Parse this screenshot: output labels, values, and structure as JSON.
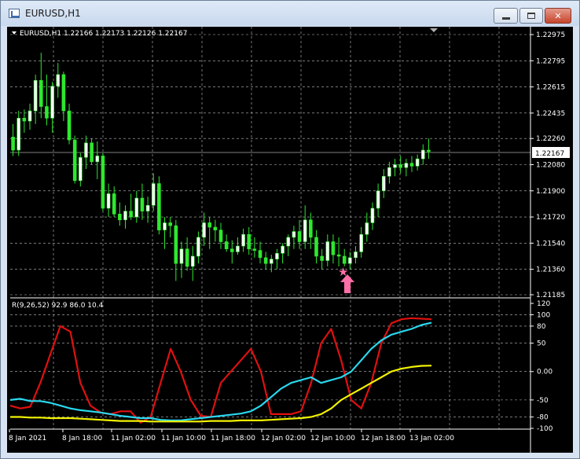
{
  "window": {
    "title": "EURUSD,H1",
    "buttons": {
      "minimize": "minimize-icon",
      "maximize": "maximize-icon",
      "close": "close-icon"
    }
  },
  "price_panel": {
    "header": "EURUSD,H1  1.22166 1.22173 1.22126 1.22167",
    "price_ticks": [
      "1.22975",
      "1.22795",
      "1.22615",
      "1.22435",
      "1.22260",
      "1.22080",
      "1.21900",
      "1.21720",
      "1.21540",
      "1.21360",
      "1.21185"
    ],
    "current_price": "1.22167",
    "markers": [
      {
        "type": "star",
        "color": "#ff6fa8"
      },
      {
        "type": "arrow-up",
        "color": "#ff6fa8"
      }
    ]
  },
  "indicator_panel": {
    "header": "R(9,26,52) 92.9 86.0 10.4",
    "ticks": [
      "120",
      "100",
      "80",
      "50",
      "0.00",
      "-50",
      "-80",
      "-100"
    ]
  },
  "time_axis": [
    "8 Jan 2021",
    "8 Jan 18:00",
    "11 Jan 02:00",
    "11 Jan 10:00",
    "11 Jan 18:00",
    "12 Jan 02:00",
    "12 Jan 10:00",
    "12 Jan 18:00",
    "13 Jan 02:00"
  ],
  "colors": {
    "background": "#000000",
    "grid": "#c0c0c0",
    "candle_up": "#ffffff",
    "candle_down": "#2ee82e",
    "red_line": "#e01010",
    "cyan_line": "#2ad8ee",
    "yellow_line": "#f2f200"
  },
  "chart_data": [
    {
      "type": "candlestick",
      "title": "EURUSD,H1",
      "ylim": [
        1.21185,
        1.22975
      ],
      "candles": [
        [
          1.2227,
          1.2236,
          1.2214,
          1.2218
        ],
        [
          1.2218,
          1.2245,
          1.2214,
          1.224
        ],
        [
          1.224,
          1.2246,
          1.223,
          1.2238
        ],
        [
          1.2238,
          1.225,
          1.2232,
          1.2245
        ],
        [
          1.2245,
          1.227,
          1.2236,
          1.2266
        ],
        [
          1.2266,
          1.2285,
          1.224,
          1.2248
        ],
        [
          1.2248,
          1.227,
          1.2235,
          1.224
        ],
        [
          1.224,
          1.2265,
          1.223,
          1.2262
        ],
        [
          1.2262,
          1.2278,
          1.2254,
          1.227
        ],
        [
          1.227,
          1.2272,
          1.2238,
          1.2245
        ],
        [
          1.2245,
          1.225,
          1.2222,
          1.2225
        ],
        [
          1.2225,
          1.2228,
          1.2195,
          1.2197
        ],
        [
          1.2197,
          1.2216,
          1.2193,
          1.2213
        ],
        [
          1.2213,
          1.2228,
          1.2205,
          1.2223
        ],
        [
          1.2223,
          1.2226,
          1.2208,
          1.221
        ],
        [
          1.221,
          1.2224,
          1.2198,
          1.2214
        ],
        [
          1.2214,
          1.2216,
          1.2176,
          1.2178
        ],
        [
          1.2178,
          1.2195,
          1.2172,
          1.2188
        ],
        [
          1.2188,
          1.2193,
          1.2172,
          1.2174
        ],
        [
          1.2174,
          1.2182,
          1.2166,
          1.217
        ],
        [
          1.217,
          1.218,
          1.2164,
          1.2176
        ],
        [
          1.2176,
          1.2188,
          1.217,
          1.2172
        ],
        [
          1.2172,
          1.219,
          1.2168,
          1.2185
        ],
        [
          1.2185,
          1.2195,
          1.217,
          1.2176
        ],
        [
          1.2176,
          1.2186,
          1.2168,
          1.218
        ],
        [
          1.218,
          1.2202,
          1.2176,
          1.2195
        ],
        [
          1.2195,
          1.22,
          1.216,
          1.2163
        ],
        [
          1.2163,
          1.2172,
          1.215,
          1.2168
        ],
        [
          1.2168,
          1.2172,
          1.2158,
          1.2166
        ],
        [
          1.2166,
          1.217,
          1.2128,
          1.214
        ],
        [
          1.214,
          1.2155,
          1.213,
          1.215
        ],
        [
          1.215,
          1.2158,
          1.2135,
          1.2138
        ],
        [
          1.2138,
          1.2152,
          1.2128,
          1.2145
        ],
        [
          1.2145,
          1.2162,
          1.214,
          1.2158
        ],
        [
          1.2158,
          1.2175,
          1.2152,
          1.2168
        ],
        [
          1.2168,
          1.2172,
          1.215,
          1.2165
        ],
        [
          1.2165,
          1.217,
          1.2155,
          1.2163
        ],
        [
          1.2163,
          1.2168,
          1.215,
          1.2155
        ],
        [
          1.2155,
          1.216,
          1.2148,
          1.215
        ],
        [
          1.215,
          1.2156,
          1.214,
          1.2148
        ],
        [
          1.2148,
          1.2158,
          1.2146,
          1.2152
        ],
        [
          1.2152,
          1.2164,
          1.2148,
          1.216
        ],
        [
          1.216,
          1.2165,
          1.2146,
          1.215
        ],
        [
          1.215,
          1.2158,
          1.2144,
          1.2149
        ],
        [
          1.2149,
          1.2155,
          1.214,
          1.2144
        ],
        [
          1.2144,
          1.2148,
          1.2136,
          1.214
        ],
        [
          1.214,
          1.2146,
          1.2134,
          1.2143
        ],
        [
          1.2143,
          1.215,
          1.2136,
          1.2147
        ],
        [
          1.2147,
          1.2154,
          1.214,
          1.2152
        ],
        [
          1.2152,
          1.216,
          1.2145,
          1.2158
        ],
        [
          1.2158,
          1.2166,
          1.215,
          1.2162
        ],
        [
          1.2162,
          1.217,
          1.215,
          1.2155
        ],
        [
          1.2155,
          1.218,
          1.215,
          1.217
        ],
        [
          1.217,
          1.2175,
          1.215,
          1.2158
        ],
        [
          1.2158,
          1.2163,
          1.214,
          1.2145
        ],
        [
          1.2145,
          1.215,
          1.2136,
          1.2142
        ],
        [
          1.2142,
          1.216,
          1.2138,
          1.2155
        ],
        [
          1.2155,
          1.216,
          1.214,
          1.2146
        ],
        [
          1.2146,
          1.2158,
          1.2138,
          1.2145
        ],
        [
          1.2145,
          1.215,
          1.2138,
          1.214
        ],
        [
          1.214,
          1.2148,
          1.2136,
          1.2144
        ],
        [
          1.2144,
          1.2152,
          1.214,
          1.2148
        ],
        [
          1.2148,
          1.2165,
          1.2144,
          1.216
        ],
        [
          1.216,
          1.2175,
          1.2155,
          1.2168
        ],
        [
          1.2168,
          1.2182,
          1.2163,
          1.2178
        ],
        [
          1.2178,
          1.2195,
          1.2172,
          1.219
        ],
        [
          1.219,
          1.2205,
          1.2185,
          1.22
        ],
        [
          1.22,
          1.221,
          1.2195,
          1.2206
        ],
        [
          1.2206,
          1.2212,
          1.22,
          1.2208
        ],
        [
          1.2208,
          1.2214,
          1.2202,
          1.2206
        ],
        [
          1.2206,
          1.2212,
          1.22,
          1.2209
        ],
        [
          1.2209,
          1.2214,
          1.2203,
          1.2207
        ],
        [
          1.2207,
          1.2215,
          1.2204,
          1.2212
        ],
        [
          1.2212,
          1.2222,
          1.2208,
          1.2218
        ],
        [
          1.2218,
          1.2226,
          1.2212,
          1.2217
        ]
      ]
    },
    {
      "type": "line",
      "title": "R(9,26,52)",
      "ylim": [
        -100,
        120
      ],
      "series": [
        {
          "color": "#e01010",
          "values": [
            -60,
            -65,
            -62,
            -20,
            30,
            80,
            70,
            -20,
            -60,
            -72,
            -75,
            -70,
            -70,
            -90,
            -80,
            -20,
            40,
            0,
            -50,
            -78,
            -80,
            -20,
            0,
            20,
            40,
            0,
            -75,
            -75,
            -75,
            -70,
            -20,
            50,
            75,
            20,
            -50,
            -65,
            -20,
            50,
            85,
            92,
            94,
            93,
            92
          ]
        },
        {
          "color": "#2ad8ee",
          "values": [
            -50,
            -48,
            -52,
            -52,
            -55,
            -60,
            -65,
            -68,
            -70,
            -72,
            -75,
            -78,
            -80,
            -82,
            -82,
            -85,
            -86,
            -86,
            -84,
            -82,
            -80,
            -78,
            -76,
            -74,
            -70,
            -60,
            -45,
            -30,
            -20,
            -15,
            -10,
            -20,
            -15,
            -10,
            0,
            20,
            40,
            55,
            65,
            70,
            75,
            82,
            86
          ]
        },
        {
          "color": "#f2f200",
          "values": [
            -80,
            -80,
            -81,
            -81,
            -82,
            -82,
            -82,
            -83,
            -84,
            -85,
            -86,
            -87,
            -87,
            -87,
            -88,
            -88,
            -88,
            -88,
            -88,
            -88,
            -87,
            -87,
            -87,
            -86,
            -86,
            -86,
            -85,
            -84,
            -83,
            -82,
            -80,
            -75,
            -65,
            -50,
            -40,
            -30,
            -20,
            -10,
            0,
            5,
            8,
            10,
            10.4
          ]
        }
      ]
    }
  ]
}
